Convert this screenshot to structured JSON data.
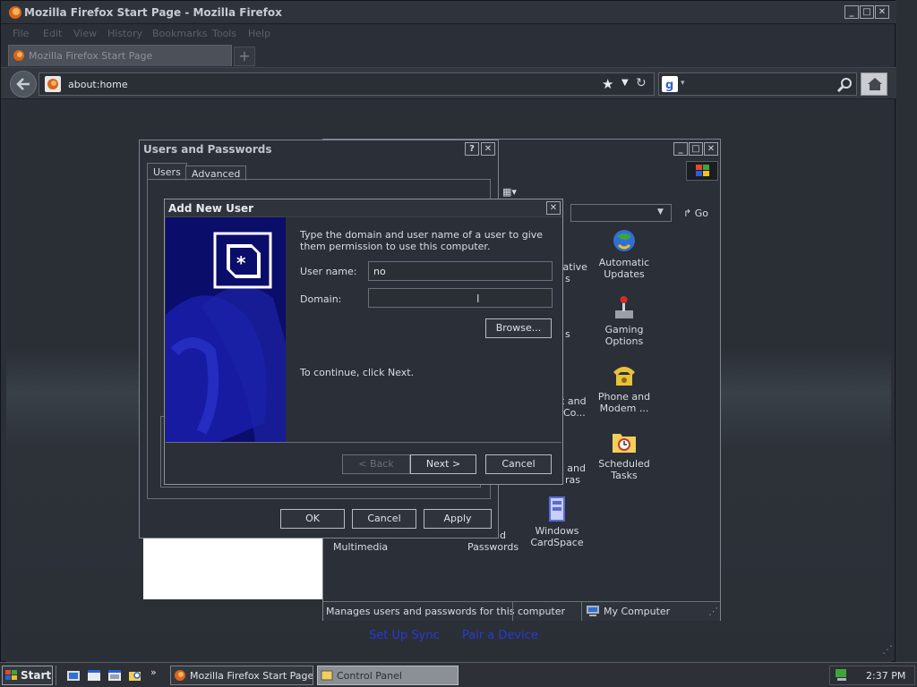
{
  "firefox": {
    "title": "Mozilla Firefox Start Page - Mozilla Firefox",
    "menu": [
      "File",
      "Edit",
      "View",
      "History",
      "Bookmarks",
      "Tools",
      "Help"
    ],
    "tab_label": "Mozilla Firefox Start Page",
    "url": "about:home",
    "start_links": [
      "Set Up Sync",
      "Pair a Device"
    ]
  },
  "control_panel": {
    "go_label": "Go",
    "items": [
      {
        "label": "Automatic Updates",
        "icon": "globe-icon"
      },
      {
        "label": "Gaming Options",
        "icon": "joystick-icon"
      },
      {
        "label": "Phone and Modem ...",
        "icon": "phone-icon"
      },
      {
        "label": "Scheduled Tasks",
        "icon": "folder-clock-icon"
      },
      {
        "label": "Windows CardSpace",
        "icon": "card-icon"
      }
    ],
    "partial_labels": {
      "administrative": "rative",
      "administrative2": "s",
      "fonts": "s",
      "keyboard_a": "k and",
      "keyboard_b": "Co...",
      "scanners_a": "s and",
      "scanners_b": "ras",
      "multimedia": "Multimedia",
      "passwords_a": "nd",
      "passwords_b": "Passwords"
    },
    "status_text": "Manages users and passwords for this computer",
    "status_zone": "My Computer"
  },
  "users_passwords": {
    "title": "Users and Passwords",
    "tabs": [
      "Users",
      "Advanced"
    ],
    "ok": "OK",
    "cancel": "Cancel",
    "apply": "Apply"
  },
  "add_user": {
    "title": "Add New User",
    "instructions": "Type the domain and user name of a user to give them permission to use this computer.",
    "user_name_label": "User name:",
    "user_name_value": "no",
    "domain_label": "Domain:",
    "domain_value": "",
    "browse": "Browse...",
    "continue_text": "To continue, click Next.",
    "back": "< Back",
    "next": "Next >",
    "cancel": "Cancel"
  },
  "taskbar": {
    "start": "Start",
    "tasks": [
      {
        "label": "Mozilla Firefox Start Page...",
        "active": false
      },
      {
        "label": "Control Panel",
        "active": true
      }
    ],
    "clock": "2:37 PM"
  }
}
